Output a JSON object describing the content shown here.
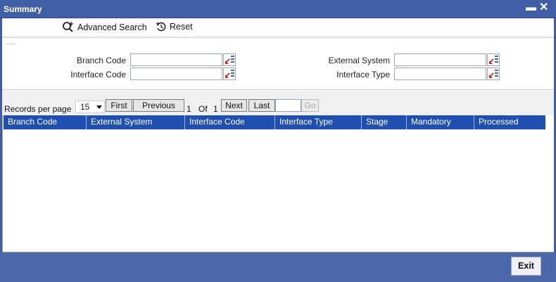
{
  "window": {
    "title": "Summary",
    "minimize": "▬",
    "close": "✕"
  },
  "toolbar": {
    "advanced_search": "Advanced Search",
    "reset": "Reset"
  },
  "criteria": {
    "branch_code_label": "Branch Code",
    "interface_code_label": "Interface Code",
    "external_system_label": "External System",
    "interface_type_label": "Interface Type",
    "branch_code_value": "",
    "interface_code_value": "",
    "external_system_value": "",
    "interface_type_value": ""
  },
  "pagination": {
    "records_per_page_label": "Records per page",
    "records_per_page_value": "15",
    "first": "First",
    "previous": "Previous",
    "current_page": "1",
    "of_label": "Of",
    "total_pages": "1",
    "next": "Next",
    "last": "Last",
    "go": "Go",
    "page_input_value": ""
  },
  "grid": {
    "columns": [
      "Branch Code",
      "External System",
      "Interface Code",
      "Interface Type",
      "Stage",
      "Mandatory",
      "Processed"
    ],
    "rows": []
  },
  "footer": {
    "exit": "Exit"
  },
  "colors": {
    "titlebar": "#3f5ea6",
    "grid_header": "#1f4fb0",
    "footer": "#4a67a8"
  }
}
